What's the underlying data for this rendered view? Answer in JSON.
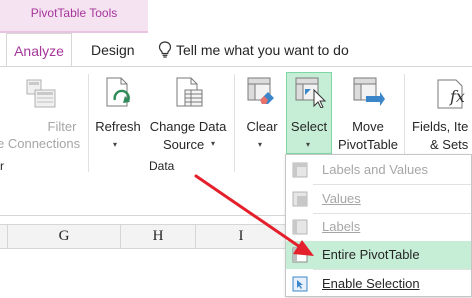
{
  "contextual_tab": {
    "label": "PivotTable Tools"
  },
  "tabs": [
    {
      "label": "Analyze",
      "active": true
    },
    {
      "label": "Design",
      "active": false
    }
  ],
  "tell_me": {
    "text": "Tell me what you want to do"
  },
  "ribbon": {
    "filter_group": {
      "filter_line1": "Filter",
      "filter_line2": "e Connections",
      "group_label_partial": "r"
    },
    "data_group": {
      "refresh_label": "Refresh",
      "change_data_line1": "Change Data",
      "change_data_line2": "Source",
      "group_label": "Data"
    },
    "actions_group": {
      "clear_label": "Clear",
      "select_label": "Select",
      "move_line1": "Move",
      "move_line2": "PivotTable"
    },
    "calc_group": {
      "fields_line1": "Fields, Ite",
      "fields_line2": "& Sets"
    }
  },
  "grid": {
    "columns": [
      "G",
      "H",
      "I"
    ]
  },
  "select_menu": {
    "items": [
      {
        "label": "Labels and Values",
        "enabled": false,
        "highlighted": false
      },
      {
        "label": "Values",
        "enabled": false,
        "highlighted": false
      },
      {
        "label": "Labels",
        "enabled": false,
        "highlighted": false
      },
      {
        "label": "Entire PivotTable",
        "enabled": true,
        "highlighted": true
      },
      {
        "label": "Enable Selection",
        "enabled": true,
        "highlighted": false
      }
    ]
  },
  "colors": {
    "contextual_accent": "#a5369a",
    "contextual_bg": "#f6e3f2",
    "highlight": "#c6eed6",
    "arrow": "#e3202b"
  }
}
